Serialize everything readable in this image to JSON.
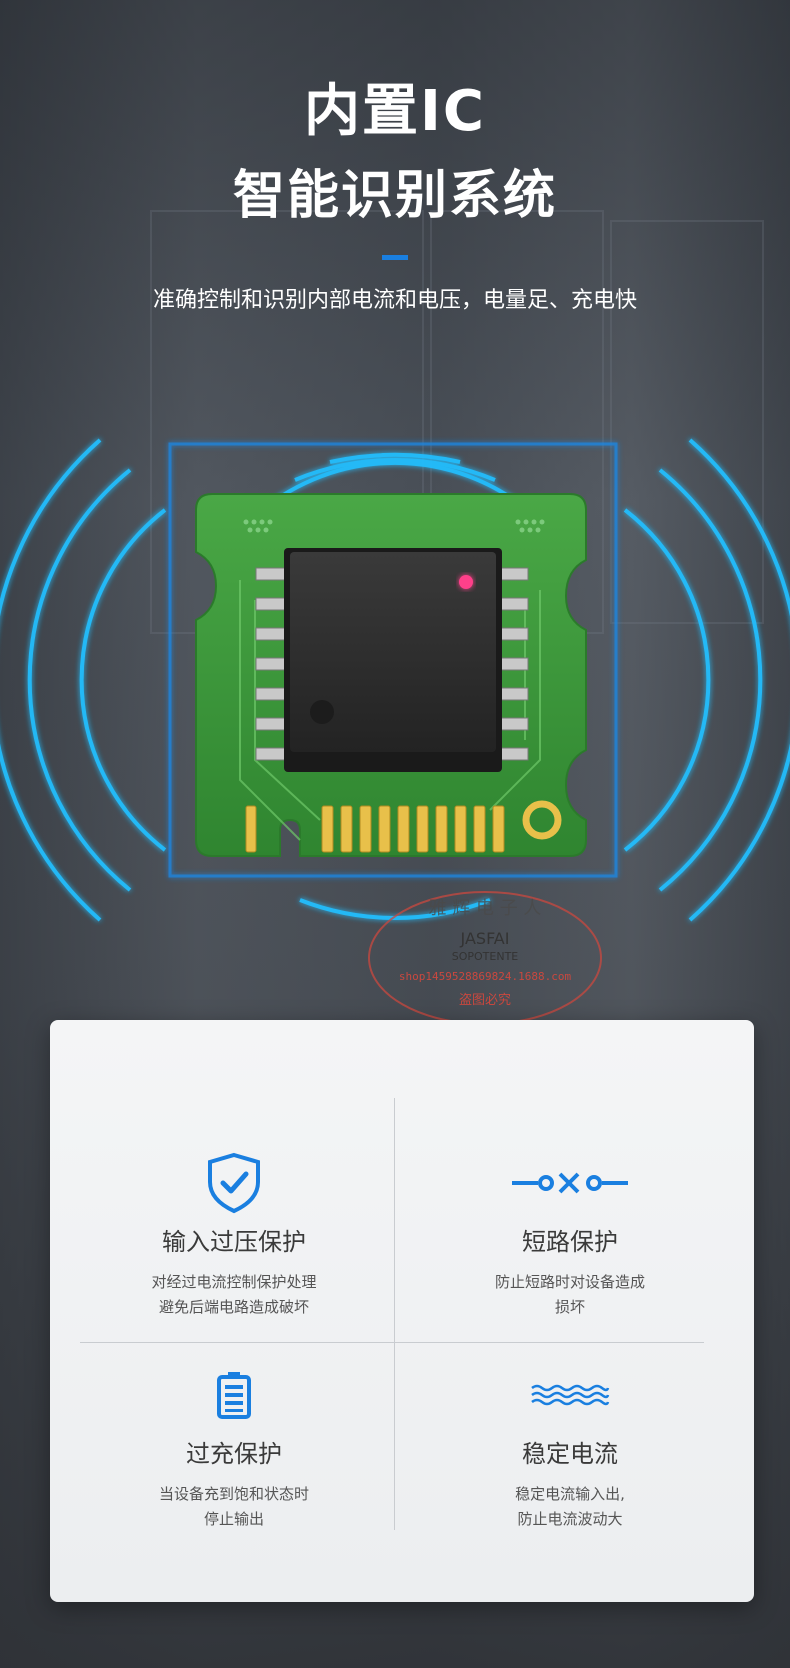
{
  "header": {
    "title_line1": "内置IC",
    "title_line2": "智能识别系统",
    "subtitle": "准确控制和识别内部电流和电压，电量足、充电快"
  },
  "watermark": {
    "line1": "雅 辉 电 子 人",
    "line2": "JASFAI",
    "line3": "SOPOTENTE",
    "line4": "shop1459528869824.1688.com",
    "line5": "盗图必究"
  },
  "colors": {
    "accent": "#1a7fe0",
    "ring": "#1fb8ff",
    "pcb": "#3e9a3c",
    "icon_blue": "#1a7fe0"
  },
  "features": [
    {
      "icon": "shield-check-icon",
      "title": "输入过压保护",
      "desc_line1": "对经过电流控制保护处理",
      "desc_line2": "避免后端电路造成破坏"
    },
    {
      "icon": "short-circuit-icon",
      "title": "短路保护",
      "desc_line1": "防止短路时对设备造成",
      "desc_line2": "损坏"
    },
    {
      "icon": "battery-icon",
      "title": "过充保护",
      "desc_line1": "当设备充到饱和状态时",
      "desc_line2": "停止输出"
    },
    {
      "icon": "wave-icon",
      "title": "稳定电流",
      "desc_line1": "稳定电流输入出,",
      "desc_line2": "防止电流波动大"
    }
  ]
}
